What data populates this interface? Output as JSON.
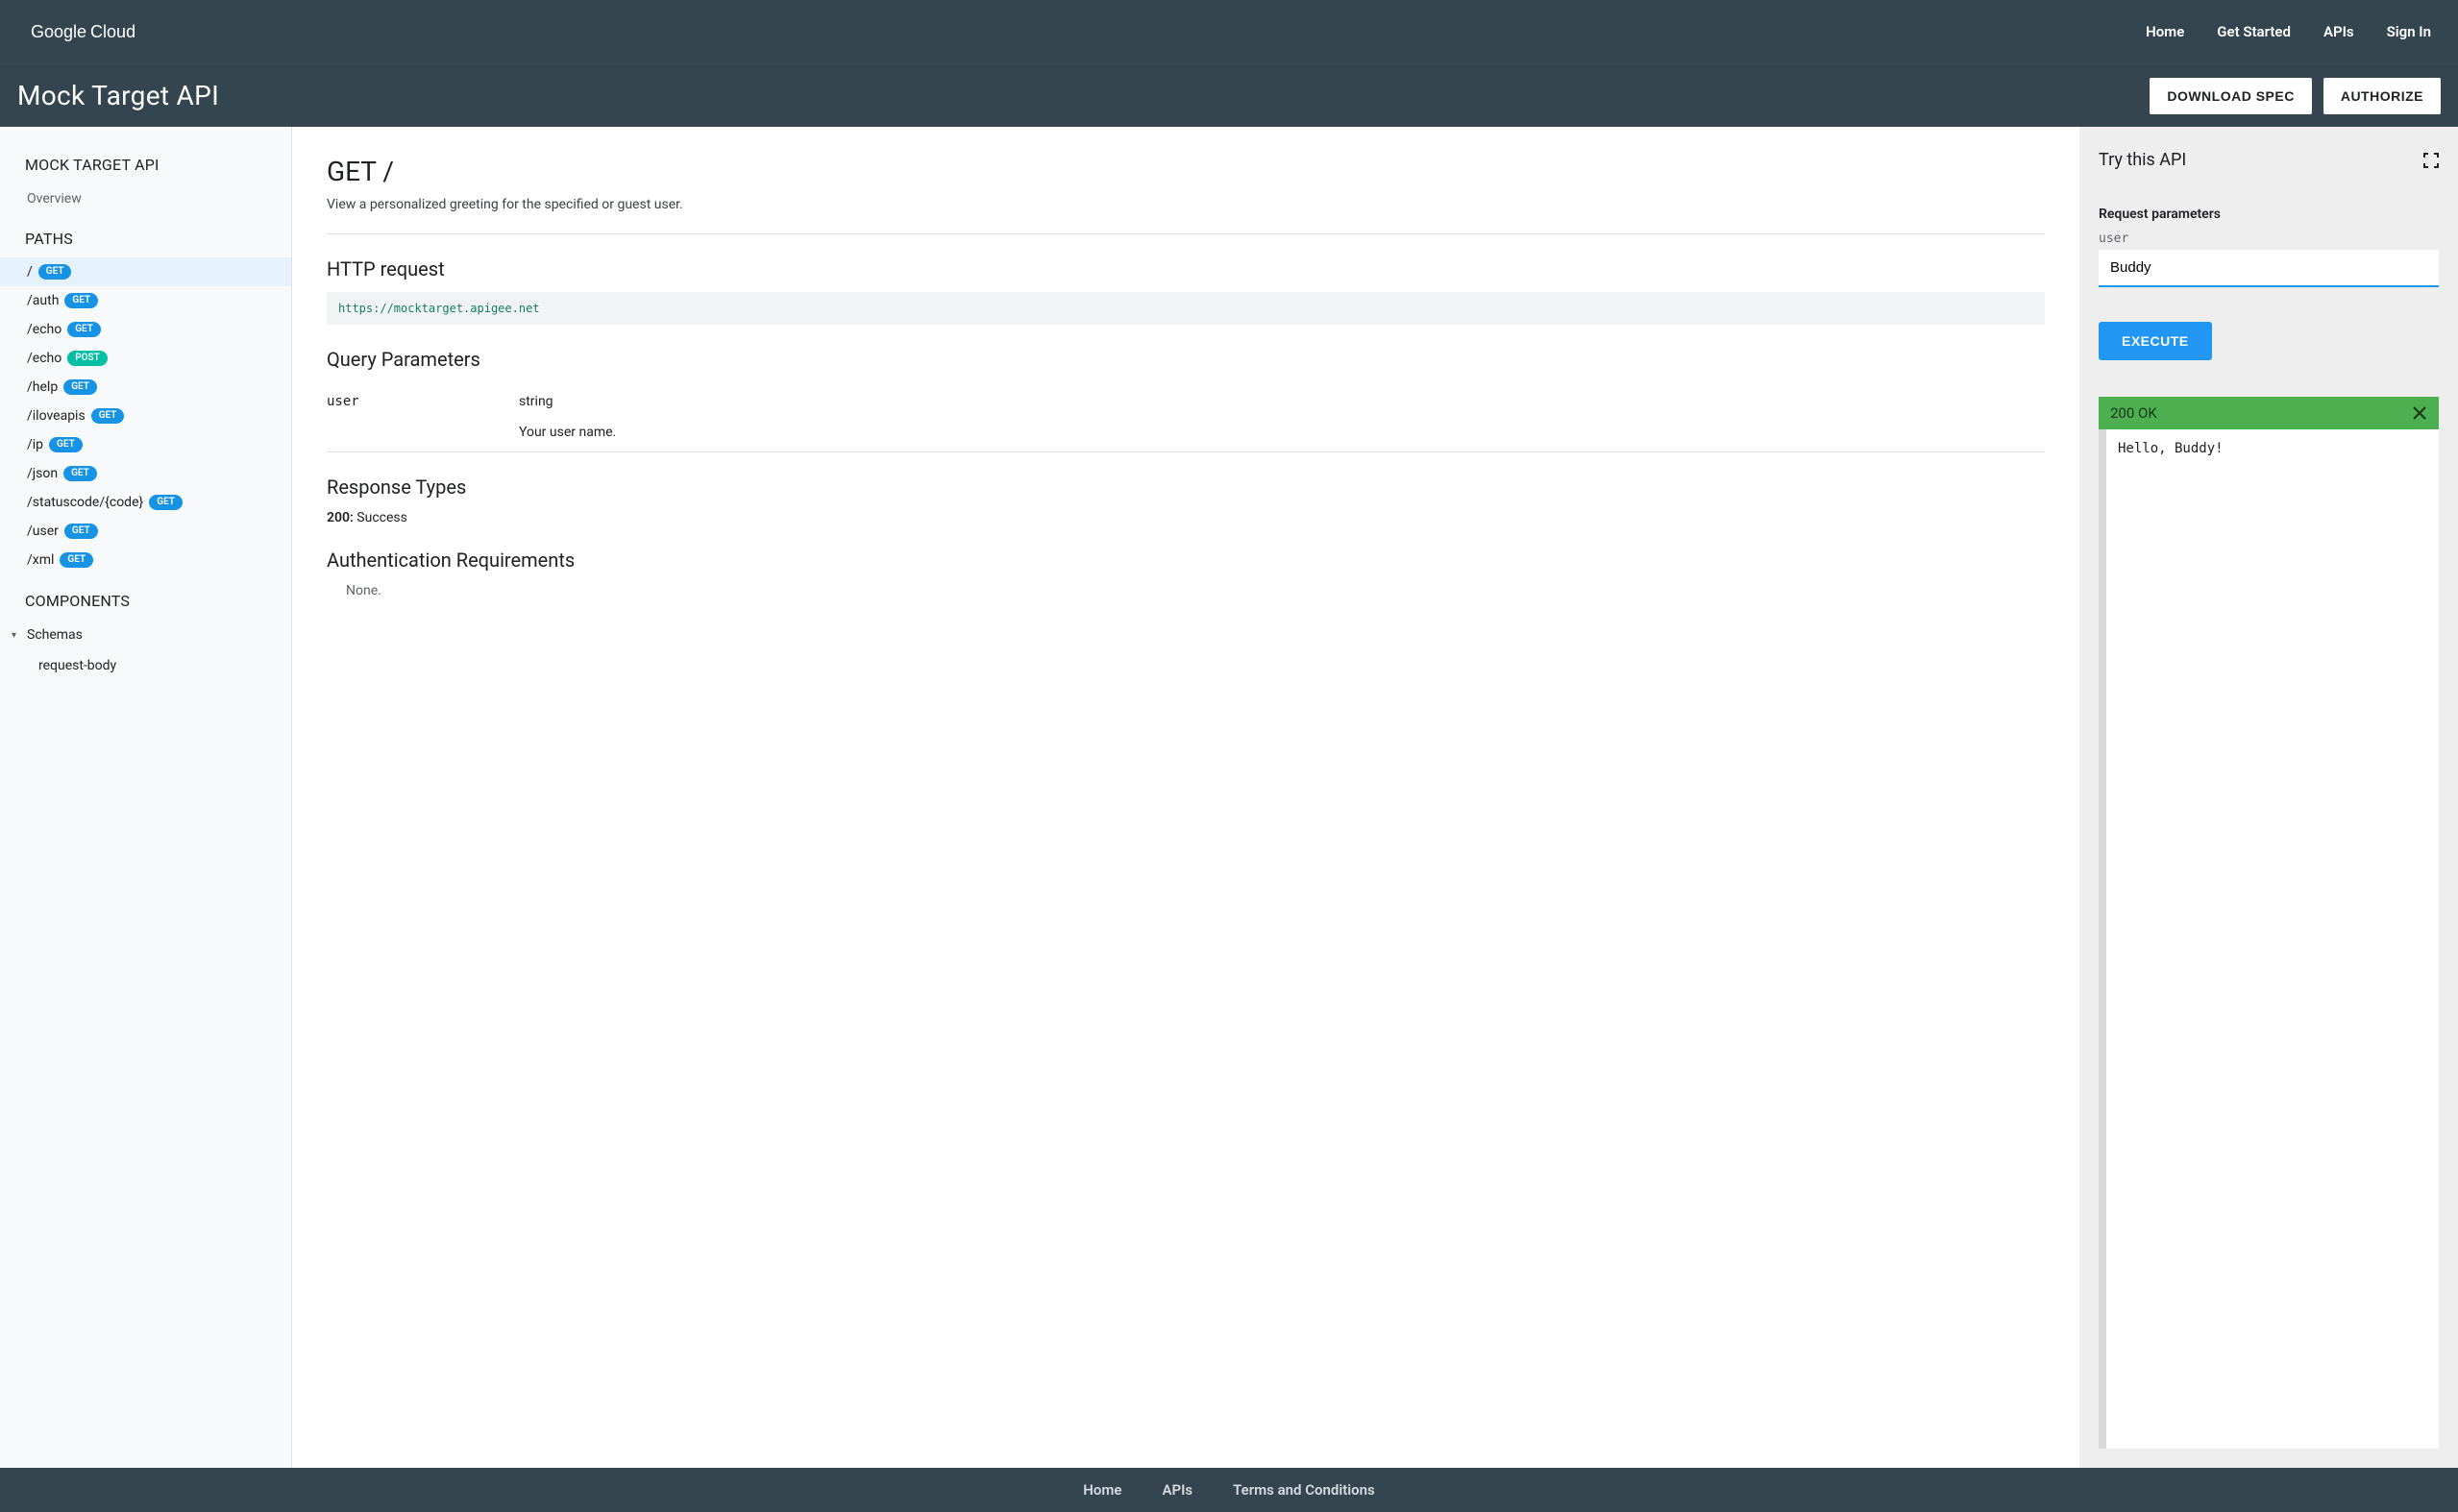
{
  "topnav": {
    "logo_product": "Google",
    "logo_suffix": "Cloud",
    "links": [
      "Home",
      "Get Started",
      "APIs",
      "Sign In"
    ]
  },
  "subheader": {
    "title": "Mock Target API",
    "download": "DOWNLOAD SPEC",
    "authorize": "AUTHORIZE"
  },
  "sidebar": {
    "section_api": "MOCK TARGET API",
    "overview": "Overview",
    "section_paths": "PATHS",
    "paths": [
      {
        "path": "/",
        "method": "GET",
        "active": true
      },
      {
        "path": "/auth",
        "method": "GET",
        "active": false
      },
      {
        "path": "/echo",
        "method": "GET",
        "active": false
      },
      {
        "path": "/echo",
        "method": "POST",
        "active": false
      },
      {
        "path": "/help",
        "method": "GET",
        "active": false
      },
      {
        "path": "/iloveapis",
        "method": "GET",
        "active": false
      },
      {
        "path": "/ip",
        "method": "GET",
        "active": false
      },
      {
        "path": "/json",
        "method": "GET",
        "active": false
      },
      {
        "path": "/statuscode/{code}",
        "method": "GET",
        "active": false
      },
      {
        "path": "/user",
        "method": "GET",
        "active": false
      },
      {
        "path": "/xml",
        "method": "GET",
        "active": false
      }
    ],
    "section_components": "COMPONENTS",
    "schemas_label": "Schemas",
    "schemas_children": [
      "request-body"
    ]
  },
  "main": {
    "title": "GET /",
    "description": "View a personalized greeting for the specified or guest user.",
    "http_request_label": "HTTP request",
    "http_request_url": "https://mocktarget.apigee.net",
    "query_params_label": "Query Parameters",
    "query_params": [
      {
        "name": "user",
        "type": "string",
        "desc": "Your user name."
      }
    ],
    "response_types_label": "Response Types",
    "response_types": [
      {
        "code": "200:",
        "desc": "Success"
      }
    ],
    "auth_label": "Authentication Requirements",
    "auth_value": "None."
  },
  "trypanel": {
    "title": "Try this API",
    "request_params_label": "Request parameters",
    "param_name": "user",
    "param_value": "Buddy",
    "execute": "EXECUTE",
    "status": "200 OK",
    "body": "Hello, Buddy!"
  },
  "footer": {
    "links": [
      "Home",
      "APIs",
      "Terms and Conditions"
    ]
  }
}
